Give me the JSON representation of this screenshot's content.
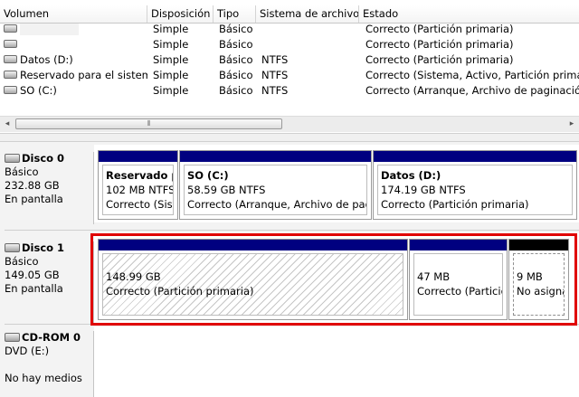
{
  "columns": [
    "Volumen",
    "Disposición",
    "Tipo",
    "Sistema de archivos",
    "Estado"
  ],
  "volumes": [
    {
      "volumen": "",
      "disposicion": "Simple",
      "tipo": "Básico",
      "sistema": "",
      "estado": "Correcto (Partición primaria)"
    },
    {
      "volumen": "",
      "disposicion": "Simple",
      "tipo": "Básico",
      "sistema": "",
      "estado": "Correcto (Partición primaria)"
    },
    {
      "volumen": "Datos (D:)",
      "disposicion": "Simple",
      "tipo": "Básico",
      "sistema": "NTFS",
      "estado": "Correcto (Partición primaria)"
    },
    {
      "volumen": "Reservado para el sistema",
      "disposicion": "Simple",
      "tipo": "Básico",
      "sistema": "NTFS",
      "estado": "Correcto (Sistema, Activo, Partición primaria)"
    },
    {
      "volumen": "SO (C:)",
      "disposicion": "Simple",
      "tipo": "Básico",
      "sistema": "NTFS",
      "estado": "Correcto (Arranque, Archivo de paginación, Volcado de memoria, Partición primaria)"
    }
  ],
  "scroll": {
    "left": "◂",
    "thumb": "⦀",
    "right": "▸"
  },
  "disks": [
    {
      "name": "Disco 0",
      "type": "Básico",
      "size": "232.88 GB",
      "status": "En pantalla",
      "partitions": [
        {
          "title": "Reservado para el sistema",
          "size": "102 MB NTFS",
          "status": "Correcto (Sistema, Activo, Partición primaria)"
        },
        {
          "title": "SO  (C:)",
          "size": "58.59 GB NTFS",
          "status": "Correcto (Arranque, Archivo de paginación, Volcado de memoria, Partición primaria)"
        },
        {
          "title": "Datos  (D:)",
          "size": "174.19 GB NTFS",
          "status": "Correcto (Partición primaria)"
        }
      ]
    },
    {
      "name": "Disco 1",
      "type": "Básico",
      "size": "149.05 GB",
      "status": "En pantalla",
      "partitions": [
        {
          "size": "148.99 GB",
          "status": "Correcto (Partición primaria)"
        },
        {
          "size": "47 MB",
          "status": "Correcto (Partición primaria)"
        },
        {
          "size": "9 MB",
          "status": "No asignado"
        }
      ]
    },
    {
      "name": "CD-ROM 0",
      "type": "DVD (E:)",
      "status": "No hay medios"
    }
  ],
  "colors": {
    "primary_bar": "#000080",
    "unallocated_bar": "#000000",
    "highlight": "#e00000"
  }
}
